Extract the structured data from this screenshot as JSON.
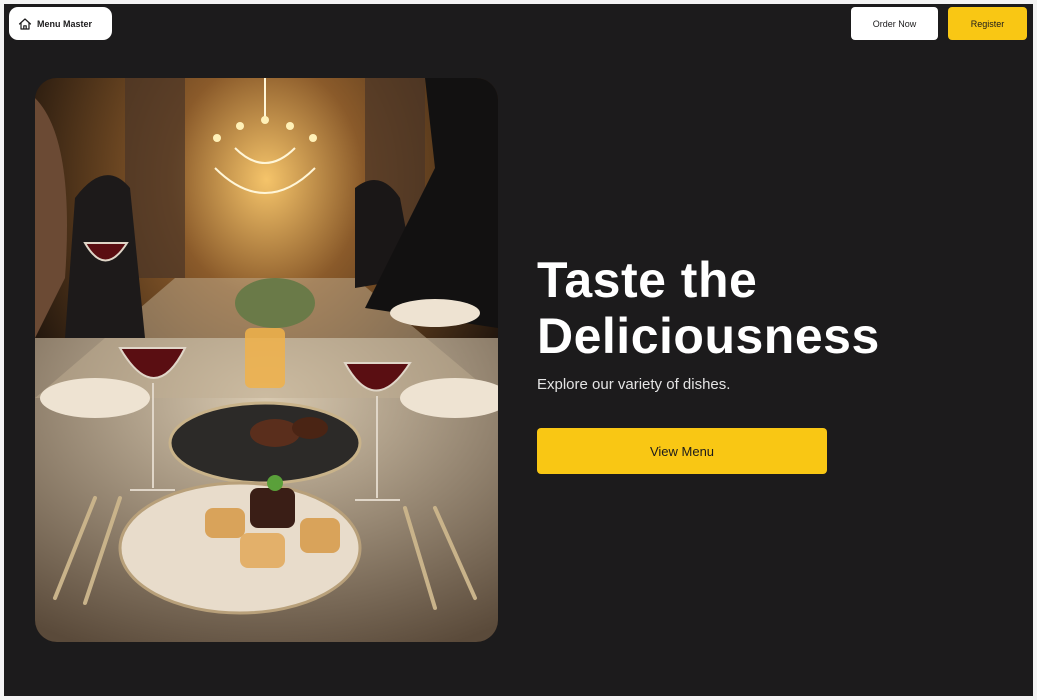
{
  "header": {
    "brand_label": "Menu Master",
    "brand_icon": "home-icon",
    "order_label": "Order Now",
    "register_label": "Register"
  },
  "hero": {
    "image_alt": "Elegant dinner table with chandelier and fine dining dishes",
    "title_line1": "Taste the",
    "title_line2": "Deliciousness",
    "subtitle": "Explore our variety of dishes.",
    "cta_label": "View Menu"
  },
  "colors": {
    "background": "#1c1b1c",
    "accent": "#f9c714",
    "button_light": "#ffffff"
  }
}
